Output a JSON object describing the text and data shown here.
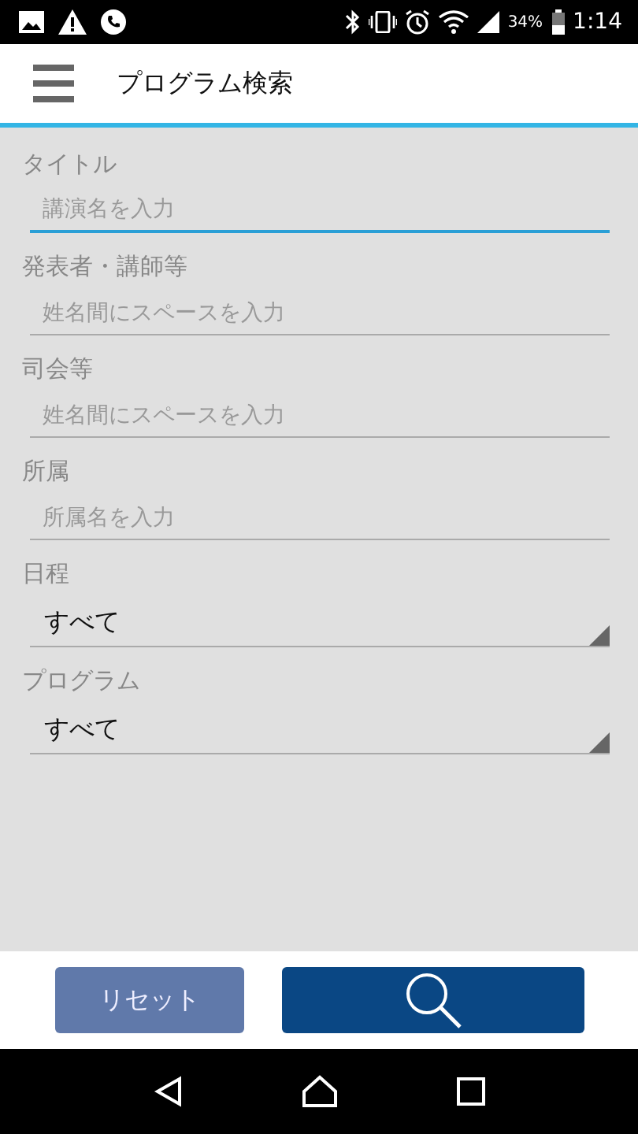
{
  "status_bar": {
    "battery_text": "34%",
    "time": "1:14"
  },
  "app_bar": {
    "title": "プログラム検索"
  },
  "fields": [
    {
      "kind": "text",
      "label": "タイトル",
      "placeholder": "講演名を入力",
      "focused": true
    },
    {
      "kind": "text",
      "label": "発表者・講師等",
      "placeholder": "姓名間にスペースを入力",
      "focused": false
    },
    {
      "kind": "text",
      "label": "司会等",
      "placeholder": "姓名間にスペースを入力",
      "focused": false
    },
    {
      "kind": "text",
      "label": "所属",
      "placeholder": "所属名を入力",
      "focused": false
    },
    {
      "kind": "select",
      "label": "日程",
      "value": "すべて"
    },
    {
      "kind": "select",
      "label": "プログラム",
      "value": "すべて"
    }
  ],
  "buttons": {
    "reset": "リセット"
  }
}
